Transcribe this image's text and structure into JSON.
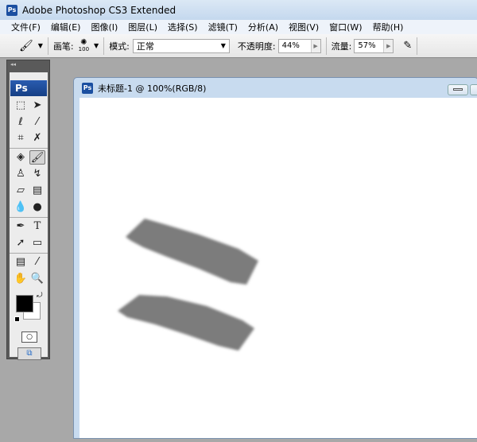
{
  "app": {
    "title": "Adobe Photoshop CS3 Extended",
    "icon": "Ps"
  },
  "menu": [
    "文件(F)",
    "编辑(E)",
    "图像(I)",
    "图层(L)",
    "选择(S)",
    "滤镜(T)",
    "分析(A)",
    "视图(V)",
    "窗口(W)",
    "帮助(H)"
  ],
  "options": {
    "brush_label": "画笔:",
    "brush_size": "100",
    "mode_label": "模式:",
    "mode_value": "正常",
    "opacity_label": "不透明度:",
    "opacity_value": "44%",
    "flow_label": "流量:",
    "flow_value": "57%"
  },
  "toolbox": {
    "collapse": "◂◂",
    "logo": "Ps"
  },
  "document": {
    "title": "未标题-1 @ 100%(RGB/8)",
    "icon": "Ps"
  },
  "colors": {
    "foreground": "#000000",
    "background": "#ffffff",
    "stroke": "#7a7a7a"
  }
}
